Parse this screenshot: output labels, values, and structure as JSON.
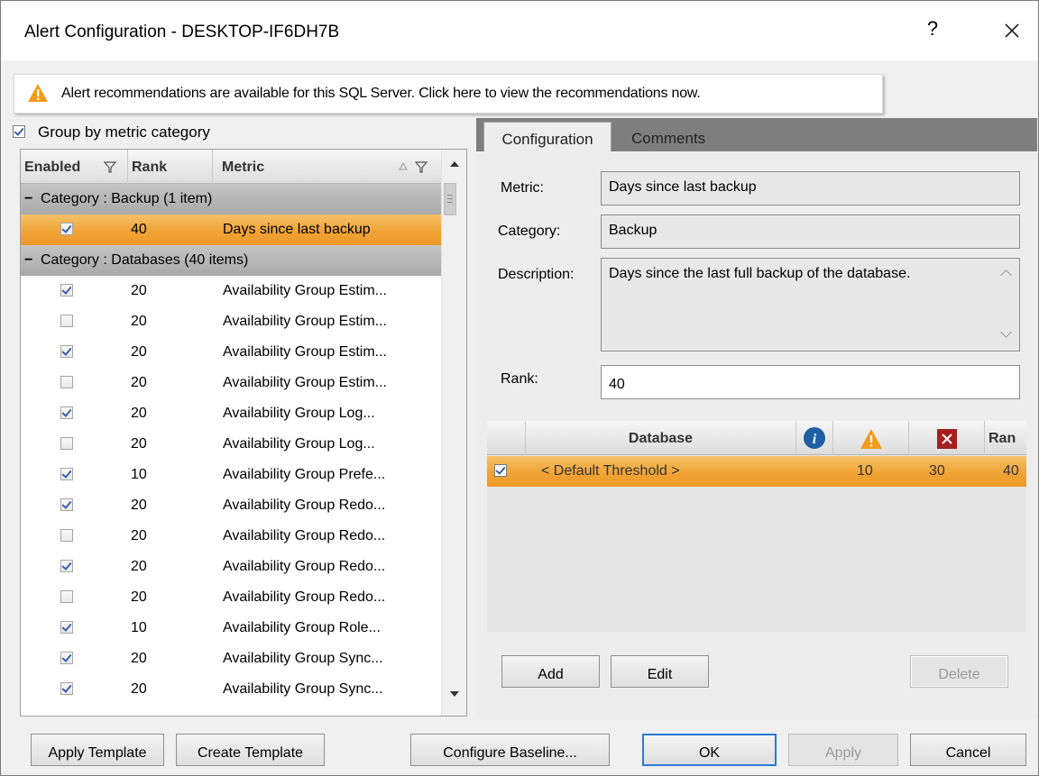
{
  "window": {
    "title": "Alert Configuration - DESKTOP-IF6DH7B",
    "help_glyph": "?",
    "close_glyph": "✕"
  },
  "recommendation_bar": {
    "text": "Alert recommendations are available for this SQL Server. Click here to view the recommendations now.",
    "icon": "warning-icon"
  },
  "group_by": {
    "label": "Group by metric category",
    "checked": true
  },
  "metric_grid": {
    "columns": {
      "enabled": "Enabled",
      "rank": "Rank",
      "metric": "Metric"
    },
    "categories": [
      {
        "label": "Category : Backup (1 item)"
      },
      {
        "label": "Category : Databases (40 items)"
      }
    ],
    "backup_rows": [
      {
        "enabled": true,
        "rank": "40",
        "metric": "Days since last backup",
        "selected": true
      }
    ],
    "database_rows": [
      {
        "enabled": true,
        "rank": "20",
        "metric": "Availability Group Estim..."
      },
      {
        "enabled": false,
        "rank": "20",
        "metric": "Availability Group Estim..."
      },
      {
        "enabled": true,
        "rank": "20",
        "metric": "Availability Group Estim..."
      },
      {
        "enabled": false,
        "rank": "20",
        "metric": "Availability Group Estim..."
      },
      {
        "enabled": true,
        "rank": "20",
        "metric": "Availability Group Log..."
      },
      {
        "enabled": false,
        "rank": "20",
        "metric": "Availability Group Log..."
      },
      {
        "enabled": true,
        "rank": "10",
        "metric": "Availability Group Prefe..."
      },
      {
        "enabled": true,
        "rank": "20",
        "metric": "Availability Group Redo..."
      },
      {
        "enabled": false,
        "rank": "20",
        "metric": "Availability Group Redo..."
      },
      {
        "enabled": true,
        "rank": "20",
        "metric": "Availability Group Redo..."
      },
      {
        "enabled": false,
        "rank": "20",
        "metric": "Availability Group Redo..."
      },
      {
        "enabled": true,
        "rank": "10",
        "metric": "Availability Group Role..."
      },
      {
        "enabled": true,
        "rank": "20",
        "metric": "Availability Group Sync..."
      },
      {
        "enabled": true,
        "rank": "20",
        "metric": "Availability Group Sync..."
      }
    ]
  },
  "tabs": [
    {
      "label": "Configuration",
      "active": true
    },
    {
      "label": "Comments",
      "active": false
    }
  ],
  "details": {
    "metric_label": "Metric:",
    "metric_value": "Days since last backup",
    "category_label": "Category:",
    "category_value": "Backup",
    "description_label": "Description:",
    "description_value": "Days since the last full backup of the database.",
    "rank_label": "Rank:",
    "rank_value": "40"
  },
  "threshold_grid": {
    "columns": {
      "database": "Database",
      "rank": "Ran"
    },
    "icons": [
      "info-icon",
      "warning-icon",
      "critical-icon"
    ],
    "rows": [
      {
        "checked": true,
        "database": "< Default Threshold >",
        "info": "",
        "warning": "10",
        "critical": "30",
        "rank": "40"
      }
    ]
  },
  "threshold_buttons": {
    "add": "Add",
    "edit": "Edit",
    "delete": "Delete"
  },
  "footer_buttons": {
    "apply_template": "Apply Template",
    "create_template": "Create Template",
    "configure_baseline": "Configure Baseline...",
    "ok": "OK",
    "apply": "Apply",
    "cancel": "Cancel"
  },
  "colors": {
    "selection_orange": "#f0a232",
    "category_gray": "#b3b3b3",
    "tab_bar": "#7e7e7e",
    "info_blue": "#1f5fa3",
    "warning_orange": "#f39c1b",
    "critical_red": "#a51f1f",
    "focus_blue": "#2b79d6"
  }
}
